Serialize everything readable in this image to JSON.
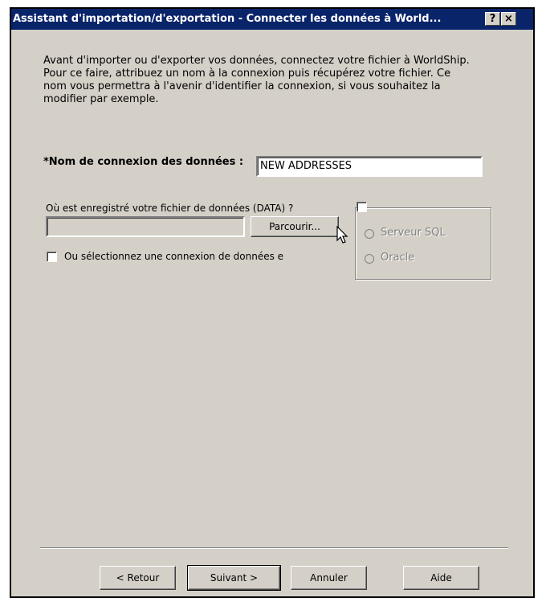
{
  "window": {
    "title": "Assistant d'importation/d'exportation - Connecter les données à World...",
    "help_button": "?",
    "close_button": "×"
  },
  "intro_text": "Avant d'importer ou d'exporter vos données, connectez votre fichier à WorldShip. Pour ce faire, attribuez un nom à la connexion puis récupérez votre fichier. Ce nom vous permettra à l'avenir d'identifier la connexion, si vous souhaitez la modifier par exemple.",
  "connection_name": {
    "label": "*Nom de connexion des données :",
    "value": "NEW ADDRESSES"
  },
  "data_file": {
    "label": "Où est enregistré votre fichier de données (DATA) ?",
    "value": "",
    "browse_label": "Parcourir..."
  },
  "select_connection": {
    "label": "Ou sélectionnez une connexion de données e",
    "checked": false
  },
  "database_group": {
    "checked": false,
    "options": [
      "Serveur SQL",
      "Oracle"
    ]
  },
  "buttons": {
    "back": "< Retour",
    "next": "Suivant >",
    "cancel": "Annuler",
    "help": "Aide"
  }
}
